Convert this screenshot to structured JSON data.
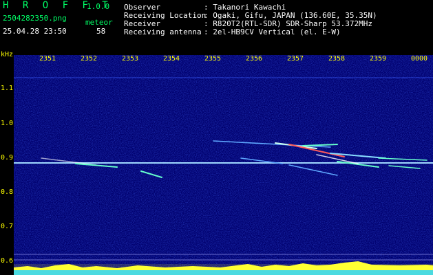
{
  "header": {
    "app_name": "H R O F F T",
    "version": "1.0.0",
    "filename": "2504282350.png",
    "category_label": "meteor",
    "datetime": "25.04.28 23:50",
    "count": "58",
    "fields": [
      {
        "label": "Observer",
        "value": ": Takanori Kawachi"
      },
      {
        "label": "Receiving Location",
        "value": ": Ogaki, Gifu, JAPAN (136.60E, 35.35N)"
      },
      {
        "label": "Receiver",
        "value": ": R820T2(RTL-SDR) SDR-Sharp 53.372MHz"
      },
      {
        "label": "Receiving antenna",
        "value": ": 2el-HB9CV Vertical (el. E-W)"
      }
    ]
  },
  "y_axis": {
    "unit": "kHz",
    "ticks": [
      "1.1",
      "1.0",
      "0.9",
      "0.8",
      "0.7",
      "0.6"
    ]
  },
  "x_axis": {
    "ticks": [
      "2351",
      "2352",
      "2353",
      "2354",
      "2355",
      "2356",
      "2357",
      "2358",
      "2359",
      "0000"
    ]
  },
  "colors": {
    "background": "#00006e",
    "label": "#ffff00",
    "header_green": "#00ff66",
    "carrier": "#9fd8ff"
  }
}
